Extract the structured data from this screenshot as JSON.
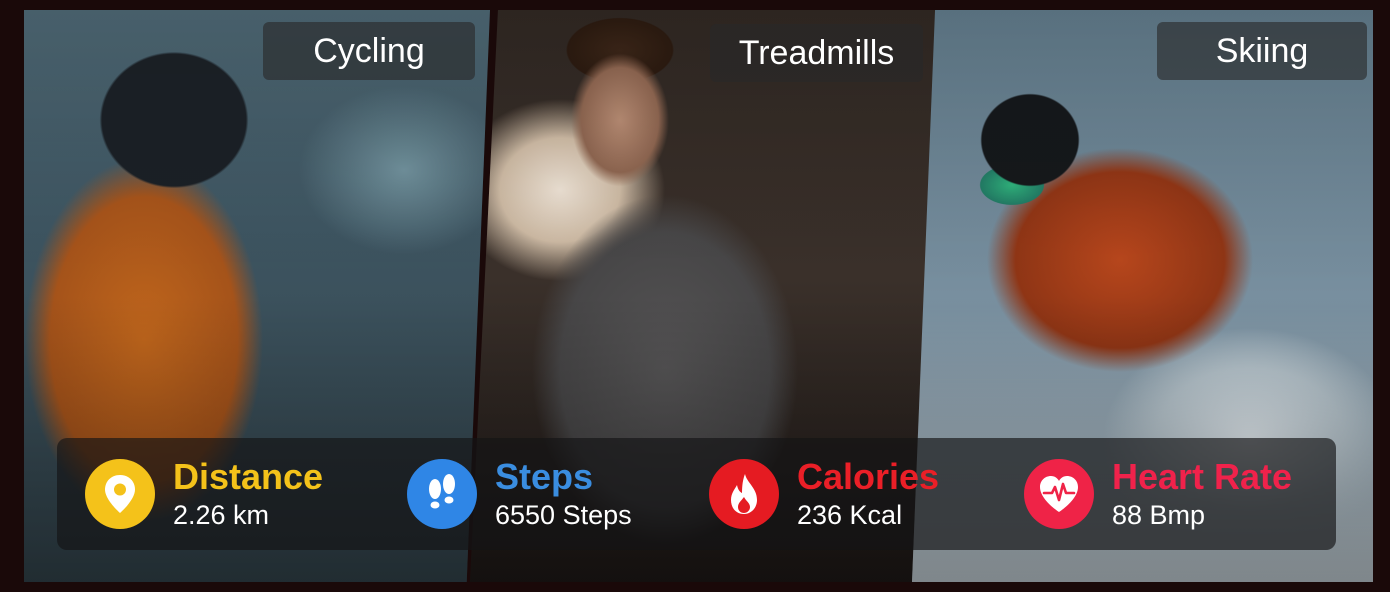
{
  "panels": [
    {
      "label": "Cycling"
    },
    {
      "label": "Treadmills"
    },
    {
      "label": "Skiing"
    }
  ],
  "stats": [
    {
      "title": "Distance",
      "value": "2.26 km",
      "icon": "location-pin-icon",
      "color": "#f4c21a",
      "icon_bg": "#f4c21a"
    },
    {
      "title": "Steps",
      "value": "6550 Steps",
      "icon": "footprints-icon",
      "color": "#3a8de0",
      "icon_bg": "#2f86e6"
    },
    {
      "title": "Calories",
      "value": "236 Kcal",
      "icon": "flame-icon",
      "color": "#ea1f27",
      "icon_bg": "#e51b22"
    },
    {
      "title": "Heart Rate",
      "value": "88 Bmp",
      "icon": "heart-pulse-icon",
      "color": "#f0224b",
      "icon_bg": "#ef2347"
    }
  ]
}
